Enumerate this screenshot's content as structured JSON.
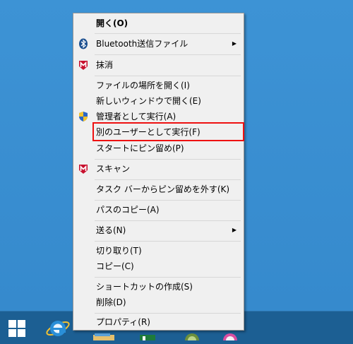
{
  "context_menu": {
    "open": "開く(O)",
    "bluetooth": "Bluetooth送信ファイル",
    "delete_mcafee": "抹消",
    "open_location": "ファイルの場所を開く(I)",
    "open_new_window": "新しいウィンドウで開く(E)",
    "run_as_admin": "管理者として実行(A)",
    "run_as_other_user": "別のユーザーとして実行(F)",
    "pin_to_start": "スタートにピン留め(P)",
    "scan": "スキャン",
    "unpin_taskbar": "タスク バーからピン留めを外す(K)",
    "copy_path": "パスのコピー(A)",
    "send_to": "送る(N)",
    "cut": "切り取り(T)",
    "copy": "コピー(C)",
    "create_shortcut": "ショートカットの作成(S)",
    "delete": "削除(D)",
    "properties": "プロパティ(R)"
  },
  "colors": {
    "highlight_border": "#ee1111",
    "mcafee_red": "#c8102e",
    "bluetooth_blue": "#1b4f8f"
  }
}
